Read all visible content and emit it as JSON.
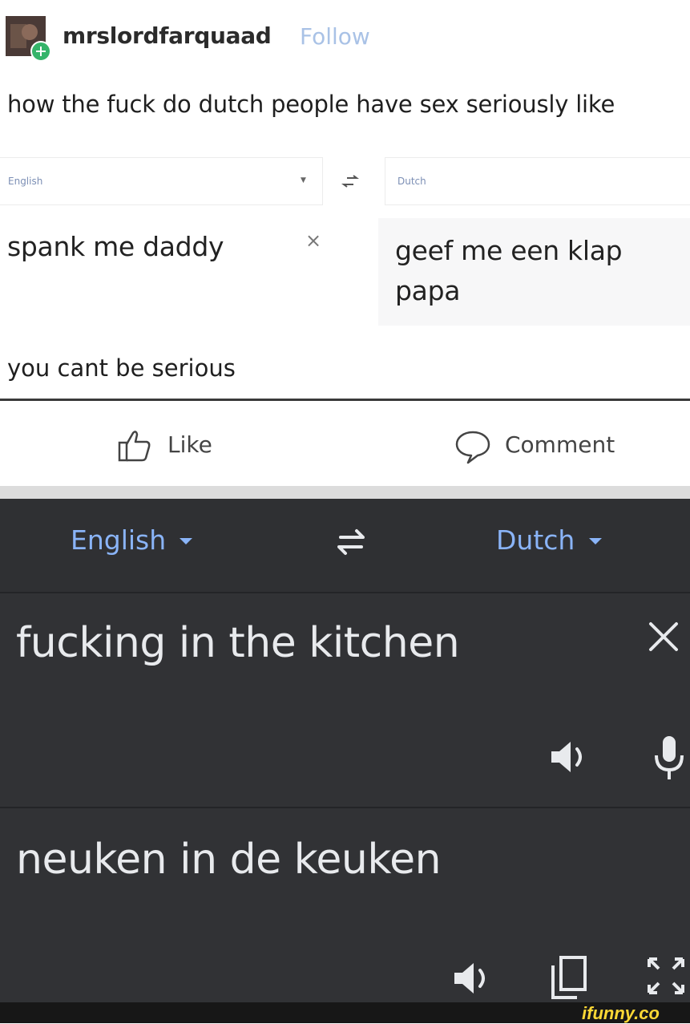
{
  "post": {
    "username": "mrslordfarquaad",
    "follow_label": "Follow",
    "text": "how the fuck do dutch people have sex seriously like",
    "mini_translator": {
      "source_lang": "English",
      "target_lang": "Dutch",
      "source_text": "spank me daddy",
      "clear_icon": "×",
      "translation": "geef me een klap papa"
    },
    "follow_up_text": "you cant be serious",
    "actions": {
      "like_label": "Like",
      "comment_label": "Comment"
    }
  },
  "translator": {
    "source_lang": "English",
    "target_lang": "Dutch",
    "input_text": "fucking in the kitchen",
    "output_text": "neuken in de keuken",
    "colors": {
      "accent": "#8ab4f8",
      "background": "#313235",
      "text": "#e8eaed"
    }
  },
  "icons": [
    "avatar",
    "swap-icon",
    "clear-icon",
    "speaker-icon",
    "mic-icon",
    "copy-icon",
    "fullscreen-icon",
    "like-icon",
    "comment-icon"
  ],
  "watermark": "ifunny.co"
}
